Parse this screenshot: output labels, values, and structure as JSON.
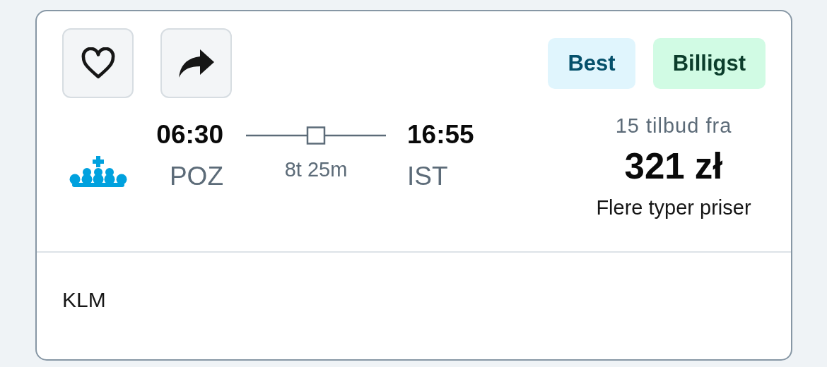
{
  "badges": [
    {
      "label": "Best",
      "kind": "best",
      "color": "#e0f5fd"
    },
    {
      "label": "Billigst",
      "kind": "cheapest",
      "color": "#d1fbe4"
    }
  ],
  "flight": {
    "departure_time": "06:30",
    "departure_airport": "POZ",
    "duration": "8t 25m",
    "arrival_time": "16:55",
    "arrival_airport": "IST"
  },
  "price": {
    "offers": "15 tilbud fra",
    "amount": "321 zł",
    "note": "Flere typer priser"
  },
  "airline": "KLM"
}
